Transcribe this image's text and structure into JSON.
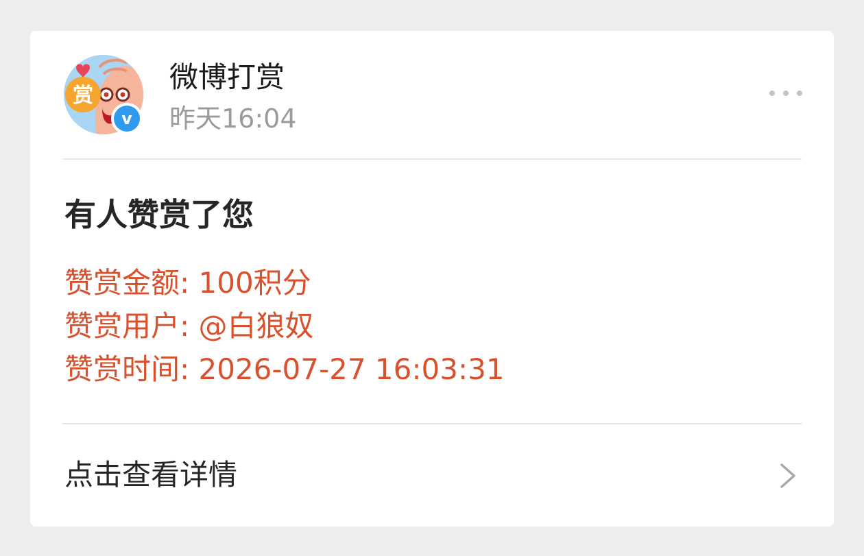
{
  "header": {
    "sender_name": "微博打赏",
    "time": "昨天16:04",
    "avatar_badge_char": "赏",
    "verified_mark": "v"
  },
  "message": {
    "title": "有人赞赏了您",
    "lines": [
      "赞赏金额: 100积分",
      "赞赏用户: @白狼奴",
      "赞赏时间: 2026-07-27 16:03:31"
    ]
  },
  "footer": {
    "details_label": "点击查看详情"
  },
  "icons": {
    "more": "more-dots-icon",
    "chevron": "chevron-right-icon",
    "verified": "verified-badge-icon"
  },
  "colors": {
    "background": "#ededed",
    "card": "#ffffff",
    "accent_text": "#d9512c",
    "verified_blue": "#2f9bf0"
  }
}
